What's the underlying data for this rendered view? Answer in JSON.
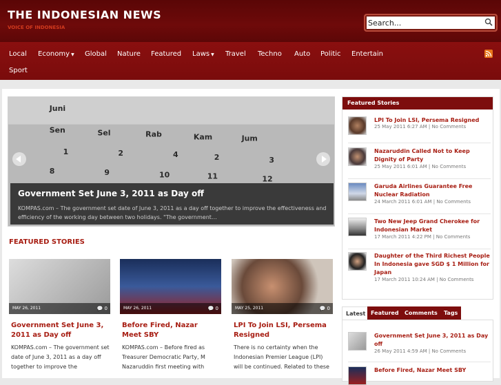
{
  "site": {
    "title": "THE INDONESIAN NEWS",
    "tagline": "VOICE OF INDONESIA"
  },
  "search": {
    "placeholder": "Search..."
  },
  "nav": [
    {
      "label": "Local"
    },
    {
      "label": "Economy",
      "dropdown": true
    },
    {
      "label": "Global"
    },
    {
      "label": "Nature"
    },
    {
      "label": "Featured"
    },
    {
      "label": "Laws",
      "dropdown": true
    },
    {
      "label": "Travel"
    },
    {
      "label": "Techno"
    },
    {
      "label": "Auto"
    },
    {
      "label": "Politic"
    },
    {
      "label": "Entertain"
    },
    {
      "label": "Sport"
    }
  ],
  "slider": {
    "title": "Government Set June 3, 2011 as Day off",
    "excerpt": "KOMPAS.com – The government set date of June 3, 2011 as a day off together to improve the effectiveness and efficiency of the working day between two holidays. \"The government…"
  },
  "featured_section": {
    "title": "FEATURED STORIES"
  },
  "cards": [
    {
      "date": "MAY 26, 2011",
      "comments": "0",
      "title": "Government Set June 3, 2011 as Day off",
      "excerpt": "KOMPAS.com – The government set date of June 3, 2011 as a day off together to improve the"
    },
    {
      "date": "MAY 26, 2011",
      "comments": "0",
      "title": "Before Fired, Nazar Meet SBY",
      "excerpt": "KOMPAS.com – Before fired as Treasurer Democratic Party, M Nazaruddin first meeting with"
    },
    {
      "date": "MAY 25, 2011",
      "comments": "0",
      "title": "LPI To Join LSI, Persema Resigned",
      "excerpt": "There is no certainty when the Indonesian Premier League (LPI) will be continued. Related to these"
    }
  ],
  "sidebar": {
    "featured_title": "Featured Stories",
    "items": [
      {
        "title": "LPI To Join LSI, Persema Resigned",
        "meta": "25 May 2011 6:27 AM | No Comments"
      },
      {
        "title": "Nazaruddin Called Not to Keep Dignity of Party",
        "meta": "25 May 2011 6:01 AM | No Comments"
      },
      {
        "title": "Garuda Airlines Guarantee Free Nuclear Radiation",
        "meta": "24 March 2011 6:01 AM | No Comments"
      },
      {
        "title": "Two New Jeep Grand Cherokee for Indonesian Market",
        "meta": "17 March 2011 4:22 PM | No Comments"
      },
      {
        "title": "Daughter of the Third Richest People In Indonesia gave SGD $ 1 Million for Japan",
        "meta": "17 March 2011 10:24 AM | No Comments"
      }
    ],
    "tabs": [
      "Latest",
      "Featured",
      "Comments",
      "Tags"
    ],
    "latest": [
      {
        "title": "Government Set June 3, 2011 as Day off",
        "meta": "26 May 2011 4:59 AM | No Comments"
      },
      {
        "title": "Before Fired, Nazar Meet SBY",
        "meta": ""
      }
    ]
  },
  "colors": {
    "brand": "#7d0d0d",
    "accent": "#a71d12",
    "header": "#5a0606"
  }
}
